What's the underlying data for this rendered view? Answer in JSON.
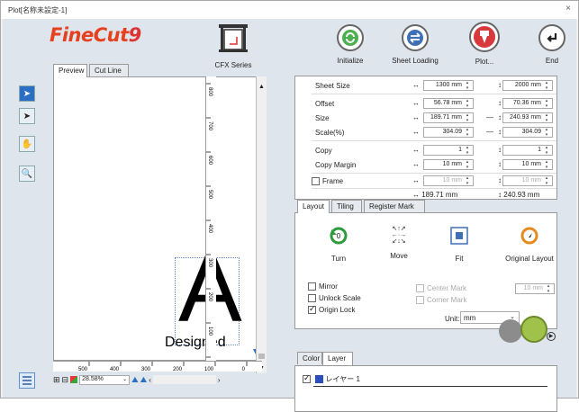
{
  "window": {
    "title": "Plot[名称未設定-1]",
    "close": "×"
  },
  "logo": {
    "text": "FineCut",
    "number": "9"
  },
  "device": {
    "label": "CFX Series"
  },
  "toolbar": [
    {
      "label": "Initialize",
      "icon": "refresh-icon"
    },
    {
      "label": "Sheet Loading",
      "icon": "swap-icon"
    },
    {
      "label": "Plot...",
      "icon": "plotter-icon"
    },
    {
      "label": "End",
      "icon": "return-icon"
    }
  ],
  "view_tabs": [
    "Preview",
    "Cut Line"
  ],
  "preview": {
    "letter": "A",
    "caption": "Designed"
  },
  "ruler": {
    "h_ticks": [
      "500",
      "400",
      "300",
      "200",
      "100",
      "0"
    ],
    "v_ticks": [
      "0",
      "100",
      "200",
      "300",
      "400",
      "500",
      "600",
      "700",
      "800"
    ]
  },
  "zoom": {
    "value": "28.58%"
  },
  "props": {
    "sheet_size": {
      "label": "Sheet Size",
      "w": "1300 mm",
      "h": "2000 mm"
    },
    "offset": {
      "label": "Offset",
      "w": "56.78 mm",
      "h": "70.36 mm"
    },
    "size": {
      "label": "Size",
      "w": "189.71 mm",
      "h": "240.93 mm"
    },
    "scale": {
      "label": "Scale(%)",
      "w": "304.09",
      "h": "304.09"
    },
    "copy": {
      "label": "Copy",
      "w": "1",
      "h": "1"
    },
    "copy_margin": {
      "label": "Copy Margin",
      "w": "10 mm",
      "h": "10 mm"
    },
    "frame": {
      "label": "Frame",
      "w": "10 mm",
      "h": "10 mm"
    },
    "total_w": "↔ 189.71 mm",
    "total_h": "↕ 240.93 mm"
  },
  "layout_tabs": [
    "Layout",
    "Tiling",
    "Register Mark"
  ],
  "layout": {
    "actions": [
      "Turn",
      "Move",
      "Fit",
      "Original Layout"
    ],
    "mirror": "Mirror",
    "unlock_scale": "Unlock Scale",
    "origin_lock": "Origin Lock",
    "center_mark": "Center Mark",
    "corner_mark": "Corner Mark",
    "mark_value": "10 mm",
    "unit_label": "Unit:",
    "unit_value": "mm"
  },
  "layer_tabs": [
    "Color",
    "Layer"
  ],
  "layer": {
    "name": "レイヤー 1"
  }
}
